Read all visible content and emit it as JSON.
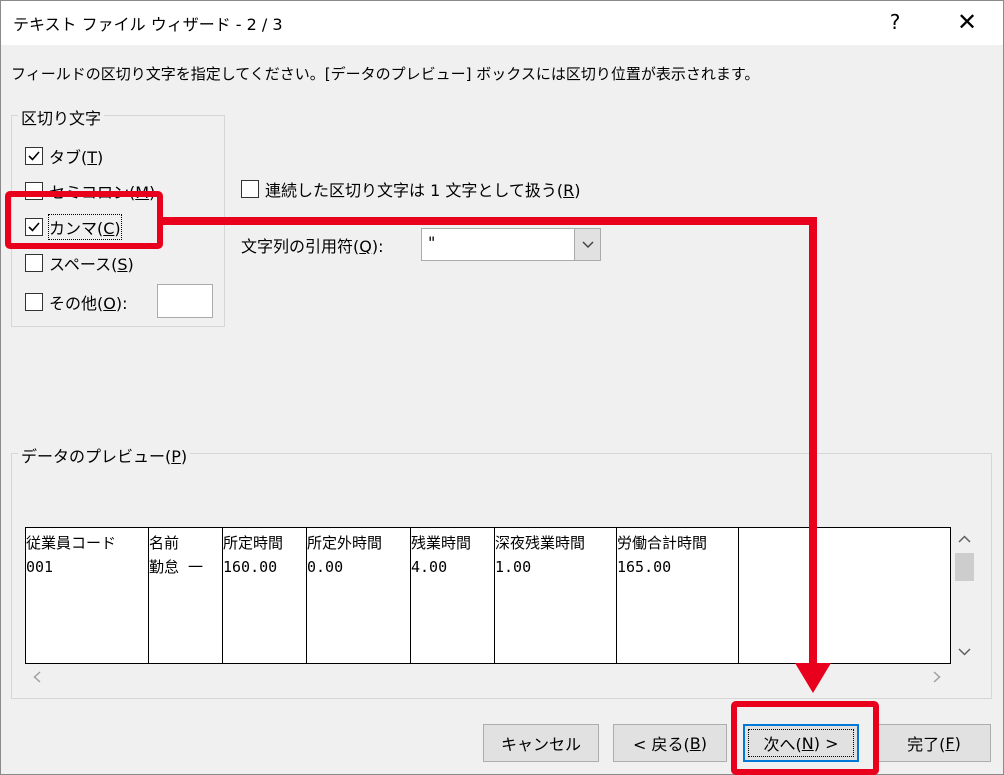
{
  "window": {
    "title": "テキスト ファイル ウィザード - 2 / 3",
    "help_label": "?",
    "close_label": "✕"
  },
  "instruction": "フィールドの区切り文字を指定してください。[データのプレビュー] ボックスには区切り位置が表示されます。",
  "delimiters": {
    "group_title": "区切り文字",
    "tab": {
      "label": "タブ(",
      "key": "T",
      "suffix": ")",
      "checked": true
    },
    "semicolon": {
      "label": "セミコロン(",
      "key": "M",
      "suffix": ")",
      "checked": false
    },
    "comma": {
      "label": "カンマ(",
      "key": "C",
      "suffix": ")",
      "checked": true
    },
    "space": {
      "label": "スペース(",
      "key": "S",
      "suffix": ")",
      "checked": false
    },
    "other": {
      "label": "その他(",
      "key": "O",
      "suffix": "):",
      "checked": false,
      "value": ""
    }
  },
  "consecutive": {
    "label": "連続した区切り文字は 1 文字として扱う(",
    "key": "R",
    "suffix": ")",
    "checked": false
  },
  "text_qualifier": {
    "label": "文字列の引用符(",
    "key": "Q",
    "suffix": "):",
    "value": "\""
  },
  "preview": {
    "group_title": "データのプレビュー(",
    "key": "P",
    "suffix": ")",
    "columns": [
      {
        "header": "従業員コード",
        "value": "001"
      },
      {
        "header": "名前",
        "value": "勤怠 一"
      },
      {
        "header": "所定時間",
        "value": "160.00"
      },
      {
        "header": "所定外時間",
        "value": "0.00"
      },
      {
        "header": "残業時間",
        "value": "4.00"
      },
      {
        "header": "深夜残業時間",
        "value": "1.00"
      },
      {
        "header": "労働合計時間",
        "value": "165.00"
      }
    ]
  },
  "buttons": {
    "cancel": "キャンセル",
    "back": {
      "label": "< 戻る(",
      "key": "B",
      "suffix": ")"
    },
    "next": {
      "label": "次へ(",
      "key": "N",
      "suffix": ") >"
    },
    "finish": {
      "label": "完了(",
      "key": "F",
      "suffix": ")"
    }
  },
  "colors": {
    "annotation": "#e8001c",
    "focus": "#0078d7"
  }
}
